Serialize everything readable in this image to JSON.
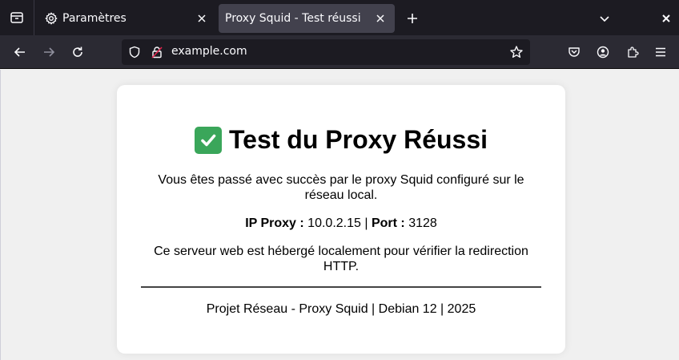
{
  "browser": {
    "tabs": [
      {
        "title": "Paramètres",
        "icon": "gear-icon",
        "active": false
      },
      {
        "title": "Proxy Squid - Test réussi",
        "active": true
      }
    ],
    "url": "example.com"
  },
  "page": {
    "heading_emoji": "✅",
    "heading": "Test du Proxy Réussi",
    "intro": "Vous êtes passé avec succès par le proxy Squid configuré sur le réseau local.",
    "ip_label": "IP Proxy :",
    "ip_value": "10.0.2.15",
    "separator": "|",
    "port_label": "Port :",
    "port_value": "3128",
    "description": "Ce serveur web est hébergé localement pour vérifier la redirection HTTP.",
    "footer": "Projet Réseau - Proxy Squid | Debian 12 | 2025"
  },
  "colors": {
    "tabbar_bg": "#1c1b22",
    "active_tab_bg": "#42414d",
    "navbar_bg": "#2b2a33",
    "check_green": "#3aa65a"
  }
}
